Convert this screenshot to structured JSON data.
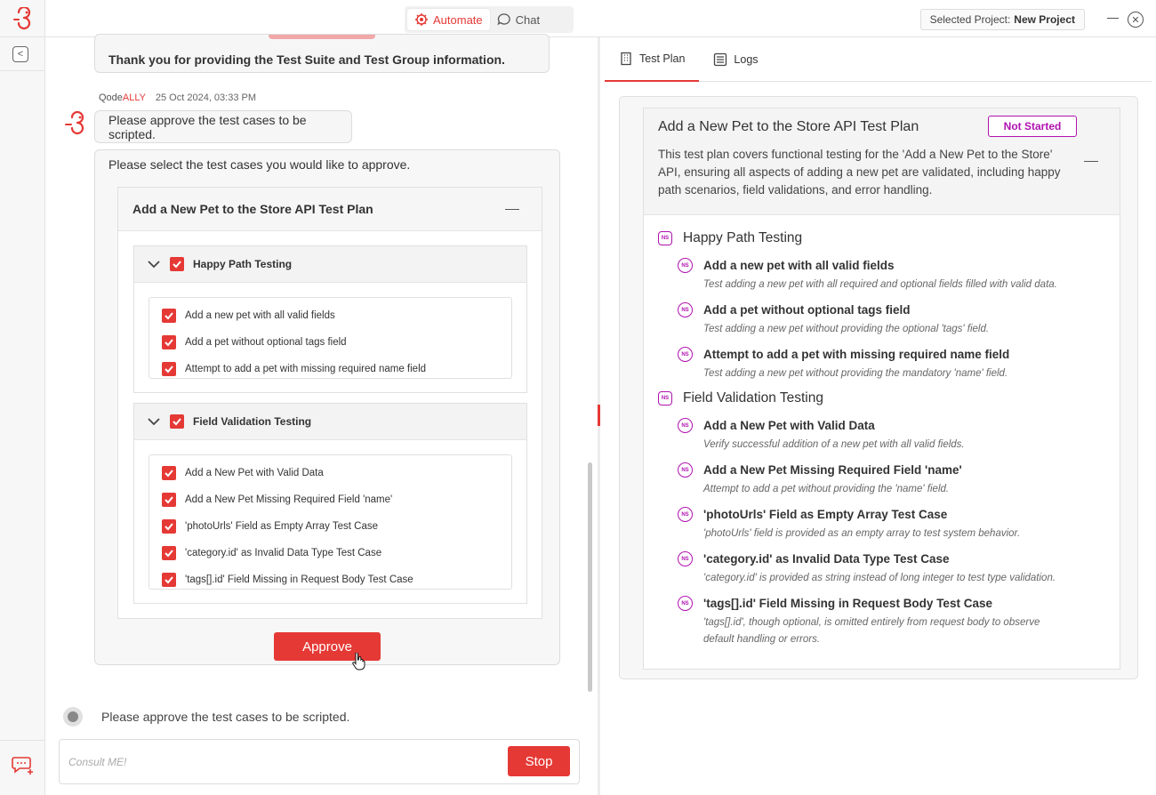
{
  "topbar": {
    "modes": [
      {
        "label": "Automate",
        "active": true
      },
      {
        "label": "Chat",
        "active": false
      }
    ],
    "project_prefix": "Selected Project:",
    "project_name": "New Project"
  },
  "chat": {
    "prev_message": "Thank you for providing the Test Suite and Test Group information.",
    "sender_first": "Qode",
    "sender_second": "ALLY",
    "timestamp": "25 Oct 2024, 03:33 PM",
    "approve_message": "Please approve the test cases to be scripted.",
    "select_prompt": "Please select the test cases you would like to approve.",
    "plan_title": "Add a New Pet to the Store API Test Plan",
    "groups": [
      {
        "name": "Happy Path Testing",
        "cases": [
          "Add a new pet with all valid fields",
          "Add a pet without optional tags field",
          "Attempt to add a pet with missing required name field"
        ]
      },
      {
        "name": "Field Validation Testing",
        "cases": [
          "Add a New Pet with Valid Data",
          "Add a New Pet Missing Required Field 'name'",
          "'photoUrls' Field as Empty Array Test Case",
          "'category.id' as Invalid Data Type Test Case",
          "'tags[].id' Field Missing in Request Body Test Case"
        ]
      }
    ],
    "approve_label": "Approve",
    "status_text": "Please approve the test cases to be scripted.",
    "input_placeholder": "Consult ME!",
    "stop_label": "Stop"
  },
  "right": {
    "tabs": [
      {
        "label": "Test Plan",
        "active": true
      },
      {
        "label": "Logs",
        "active": false
      }
    ],
    "plan": {
      "title": "Add a New Pet to the Store API Test Plan",
      "status": "Not Started",
      "description": "This test plan covers functional testing for the 'Add a New Pet to the Store' API, ensuring all aspects of adding a new pet are validated, including happy path scenarios, field validations, and error handling.",
      "ns_label": "NS",
      "groups": [
        {
          "name": "Happy Path Testing",
          "cases": [
            {
              "title": "Add a new pet with all valid fields",
              "desc": "Test adding a new pet with all required and optional fields filled with valid data."
            },
            {
              "title": "Add a pet without optional tags field",
              "desc": "Test adding a new pet without providing the optional 'tags' field."
            },
            {
              "title": "Attempt to add a pet with missing required name field",
              "desc": "Test adding a new pet without providing the mandatory 'name' field."
            }
          ]
        },
        {
          "name": "Field Validation Testing",
          "cases": [
            {
              "title": "Add a New Pet with Valid Data",
              "desc": "Verify successful addition of a new pet with all valid fields."
            },
            {
              "title": "Add a New Pet Missing Required Field 'name'",
              "desc": "Attempt to add a pet without providing the 'name' field."
            },
            {
              "title": "'photoUrls' Field as Empty Array Test Case",
              "desc": "'photoUrls' field is provided as an empty array to test system behavior."
            },
            {
              "title": "'category.id' as Invalid Data Type Test Case",
              "desc": "'category.id' is provided as string instead of long integer to test type validation."
            },
            {
              "title": "'tags[].id' Field Missing in Request Body Test Case",
              "desc": "'tags[].id', though optional, is omitted entirely from request body to observe default handling or errors."
            }
          ]
        }
      ]
    }
  },
  "colors": {
    "accent": "#e53935",
    "status_purple": "#b012b0"
  }
}
